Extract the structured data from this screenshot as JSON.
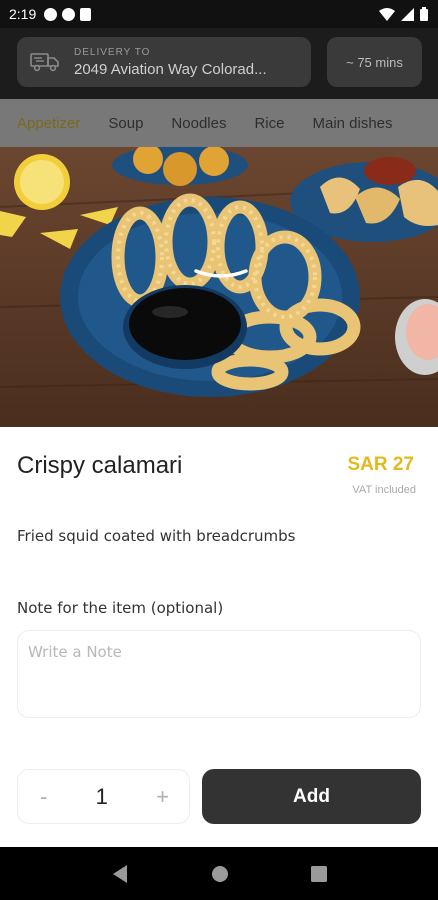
{
  "status_bar": {
    "time": "2:19",
    "left_icons": [
      "notification-icon",
      "notification-icon",
      "sim-card-icon"
    ],
    "right_icons": [
      "wifi-icon",
      "signal-icon",
      "battery-icon"
    ]
  },
  "header": {
    "delivery_label": "DELIVERY TO",
    "delivery_address": "2049 Aviation Way Colorad...",
    "eta": "~ 75 mins",
    "delivery_icon": "truck-icon"
  },
  "categories": {
    "items": [
      {
        "label": "Appetizer"
      },
      {
        "label": "Soup"
      },
      {
        "label": "Noodles"
      },
      {
        "label": "Rice"
      },
      {
        "label": "Main dishes"
      }
    ],
    "active_color": "#7a6a1e"
  },
  "item": {
    "title": "Crispy calamari",
    "price": "SAR 27",
    "vat_note": "VAT included",
    "description": "Fried squid coated with breadcrumbs",
    "price_color": "#e5b820"
  },
  "note": {
    "label": "Note for the item (optional)",
    "placeholder": "Write a Note",
    "value": ""
  },
  "quantity": {
    "minus": "-",
    "value": "1",
    "plus": "+"
  },
  "actions": {
    "add_label": "Add"
  },
  "nav_bar": {
    "icons": [
      "back-icon",
      "home-icon",
      "recents-icon"
    ]
  }
}
